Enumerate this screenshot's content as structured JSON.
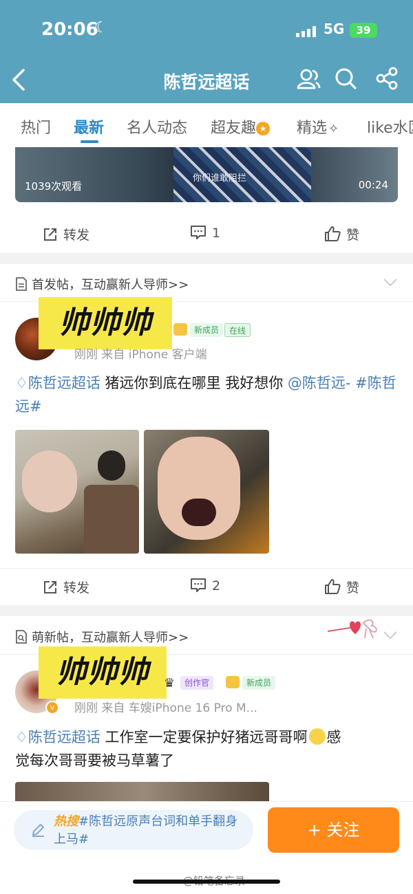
{
  "status": {
    "time": "20:06",
    "network": "5G",
    "battery": "39"
  },
  "header": {
    "title": "陈哲远超话"
  },
  "tabs": [
    {
      "label": "热门"
    },
    {
      "label": "最新"
    },
    {
      "label": "名人动态"
    },
    {
      "label": "超友趣"
    },
    {
      "label": "精选"
    },
    {
      "label": "like水区"
    }
  ],
  "video": {
    "subtitle": "你们谁敢阻拦",
    "views": "1039次观看",
    "duration": "00:24"
  },
  "post1_actions": {
    "repost": "转发",
    "comments": "1",
    "like": "赞"
  },
  "post2": {
    "section": "首发帖，互动赢新人导师>>",
    "sticker": "帅帅帅",
    "badges": [
      "新成员",
      "在线"
    ],
    "meta": "刚刚 来自 iPhone 客户端",
    "topic": "陈哲远超话",
    "text": "猪远你到底在哪里 我好想你",
    "mention": "@陈哲远-",
    "hashtag": "#陈哲远#",
    "actions": {
      "repost": "转发",
      "comments": "2",
      "like": "赞"
    }
  },
  "post3": {
    "section": "萌新帖，互动赢新人导师>>",
    "sticker": "帅帅帅",
    "badges": [
      "创作官",
      "新成员"
    ],
    "meta": "刚刚 来自 车嫂iPhone 16 Pro M...",
    "topic": "陈哲远超话",
    "text_line1": "工作室一定要保护好猪远哥哥啊",
    "text_line1_end": "感",
    "text_line2": "觉每次哥哥要被马草薯了"
  },
  "bottom": {
    "hot_tag": "热搜",
    "hot_text": "#陈哲远原声台词和单手翻身上马#",
    "follow": "+ 关注",
    "watermark": "@铅笔备忘录"
  },
  "colors": {
    "header_bg": "#5aa3bf",
    "accent": "#2a8bc7",
    "follow_bg": "#ff8a1a",
    "sticker_bg": "#f7e84a"
  }
}
